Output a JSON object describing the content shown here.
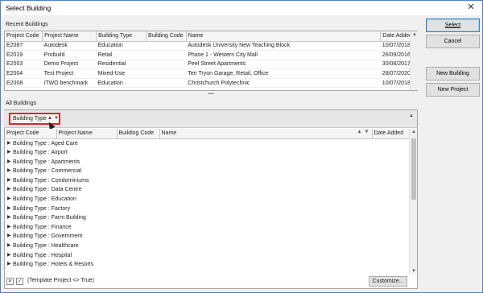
{
  "window": {
    "title": "Select Building",
    "close_glyph": "✕"
  },
  "recent": {
    "label": "Recent Buildings",
    "columns": [
      "Project Code",
      "Project Name",
      "Building Type",
      "Building Code",
      "Name",
      "Date Added"
    ],
    "rows": [
      [
        "E2087",
        "Autodesk",
        "Education",
        "",
        "Autodesk University New Teaching Block",
        "10/07/2018"
      ],
      [
        "E2019",
        "Probuild",
        "Retail",
        "",
        "Phase 1 - Western City Mall",
        "26/09/2016"
      ],
      [
        "E2003",
        "Demo Project",
        "Residential",
        "",
        "Peel Street Apartments",
        "30/08/2017"
      ],
      [
        "E2004",
        "Test Project",
        "Mixed-Use",
        "",
        "Ten Tryon Garage, Retail, Office",
        "28/07/2020"
      ],
      [
        "E2008",
        "iTWO benchmark",
        "Education",
        "",
        "Christchurch Polytechnic",
        "10/07/2018"
      ]
    ]
  },
  "splitter_glyph": "••••",
  "all": {
    "label": "All Buildings",
    "group_chip": "Building Type",
    "group_sort_glyph": "▲",
    "group_filter_glyph": "▼",
    "columns": [
      "Project Code",
      "Project Name",
      "Building Code",
      "Name",
      "Date Added"
    ],
    "name_sort_glyph": "▲",
    "name_filter_glyph": "▼",
    "groups": [
      "Building Type : Aged Care",
      "Building Type : Airport",
      "Building Type : Apartments",
      "Building Type : Commercial",
      "Building Type : Condominiums",
      "Building Type : Data Centre",
      "Building Type : Education",
      "Building Type : Factory",
      "Building Type : Farm Building",
      "Building Type : Finance",
      "Building Type : Government",
      "Building Type : Healthcare",
      "Building Type : Hospital",
      "Building Type : Hotels & Resorts"
    ],
    "expand_glyph": "▶",
    "filter_close_glyph": "✕",
    "filter_check_glyph": "✓",
    "filter_text": "(Template Project <> True)",
    "customize_label": "Customize..."
  },
  "buttons": {
    "select": "Select",
    "cancel": "Cancel",
    "new_building": "New Building",
    "new_project": "New Project"
  },
  "scroll": {
    "up": "▲",
    "down": "▼"
  }
}
